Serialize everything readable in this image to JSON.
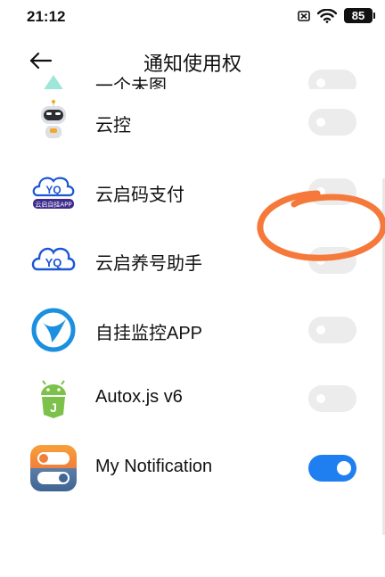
{
  "status": {
    "time": "21:12",
    "battery": "85"
  },
  "header": {
    "title": "通知使用权"
  },
  "apps": [
    {
      "name": "一个未图",
      "enabled": false
    },
    {
      "name": "云控",
      "enabled": false
    },
    {
      "name": "云启码支付",
      "enabled": false,
      "icon_text": "云启自挂APP"
    },
    {
      "name": "云启养号助手",
      "enabled": false
    },
    {
      "name": "自挂监控APP",
      "enabled": false
    },
    {
      "name": "Autox.js v6",
      "enabled": false
    },
    {
      "name": "My Notification",
      "enabled": true
    }
  ],
  "colors": {
    "toggle_on": "#1f7ff0",
    "toggle_off": "#ececec",
    "annotation": "#f5793b"
  }
}
